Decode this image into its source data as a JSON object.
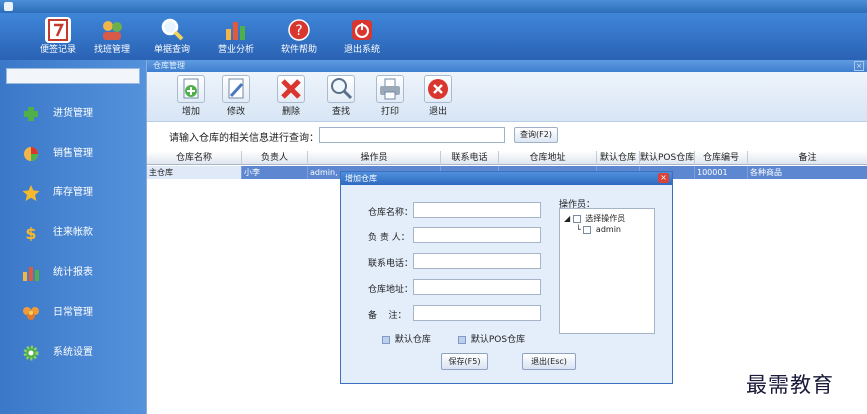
{
  "window": {
    "title": ""
  },
  "top_toolbar": {
    "buttons": [
      {
        "label": "便签记录",
        "icon": "notepad-icon"
      },
      {
        "label": "找班管理",
        "icon": "shift-icon"
      },
      {
        "label": "单据查询",
        "icon": "magnifier-icon"
      },
      {
        "label": "营业分析",
        "icon": "bar-chart-icon"
      },
      {
        "label": "软件帮助",
        "icon": "help-icon"
      },
      {
        "label": "退出系统",
        "icon": "power-icon"
      }
    ]
  },
  "sidebar": {
    "items": [
      {
        "label": "进货管理",
        "icon": "plus-icon"
      },
      {
        "label": "销售管理",
        "icon": "pie-chart-icon"
      },
      {
        "label": "库存管理",
        "icon": "star-icon"
      },
      {
        "label": "往来帐款",
        "icon": "dollar-icon"
      },
      {
        "label": "统计报表",
        "icon": "bar-chart-icon"
      },
      {
        "label": "日常管理",
        "icon": "flower-icon"
      },
      {
        "label": "系统设置",
        "icon": "gear-icon"
      }
    ]
  },
  "panel": {
    "title": "仓库管理",
    "close": "×",
    "tools": [
      {
        "label": "增加",
        "icon": "add-doc-icon"
      },
      {
        "label": "修改",
        "icon": "edit-doc-icon"
      },
      {
        "label": "删除",
        "icon": "delete-x-icon"
      },
      {
        "label": "查找",
        "icon": "search-icon"
      },
      {
        "label": "打印",
        "icon": "printer-icon"
      },
      {
        "label": "退出",
        "icon": "exit-icon"
      }
    ],
    "query": {
      "label": "请输入仓库的相关信息进行查询：",
      "value": "",
      "button": "查询(F2)"
    },
    "grid": {
      "columns": [
        "仓库名称",
        "负责人",
        "操作员",
        "联系电话",
        "仓库地址",
        "默认仓库",
        "默认POS仓库",
        "仓库编号",
        "备注"
      ],
      "rows": [
        [
          "主仓库",
          "小李",
          "admin,",
          "",
          "",
          "",
          "",
          "100001",
          "各种商品"
        ]
      ]
    }
  },
  "dialog": {
    "title": "增加仓库",
    "close": "×",
    "fields": [
      {
        "label": "仓库名称：",
        "value": ""
      },
      {
        "label": "负 责 人：",
        "value": ""
      },
      {
        "label": "联系电话：",
        "value": ""
      },
      {
        "label": "仓库地址：",
        "value": ""
      },
      {
        "label": "备    注：",
        "value": ""
      }
    ],
    "operators": {
      "label": "操作员：",
      "root": "选择操作员",
      "children": [
        "admin"
      ]
    },
    "checks": [
      "默认仓库",
      "默认POS仓库"
    ],
    "buttons": {
      "save": "保存(F5)",
      "exit": "退出(Esc)"
    }
  },
  "watermark": "最需教育",
  "colors": {
    "accent": "#2f6ac0",
    "selection": "#5d87d0",
    "danger": "#d9443a"
  }
}
